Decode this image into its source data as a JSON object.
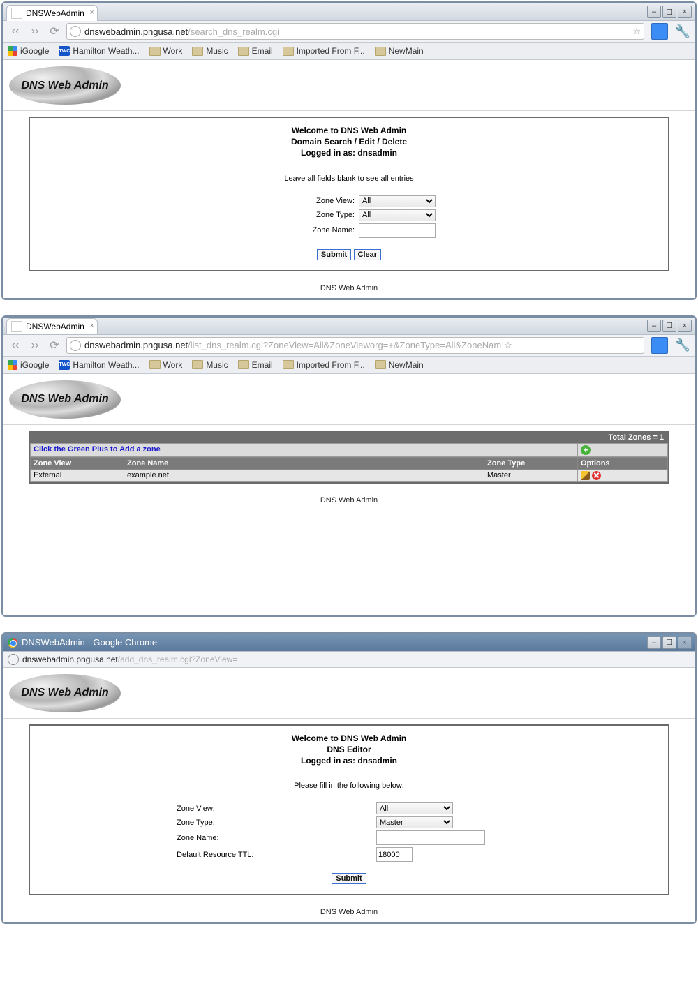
{
  "windows": [
    {
      "tab_title": "DNSWebAdmin",
      "url_host": "dnswebadmin.pngusa.net",
      "url_path": "/search_dns_realm.cgi"
    },
    {
      "tab_title": "DNSWebAdmin",
      "url_host": "dnswebadmin.pngusa.net",
      "url_path": "/list_dns_realm.cgi?ZoneView=All&ZoneVieworg=+&ZoneType=All&ZoneNam"
    },
    {
      "title": "DNSWebAdmin - Google Chrome",
      "url_host": "dnswebadmin.pngusa.net",
      "url_path": "/add_dns_realm.cgi?ZoneView="
    }
  ],
  "bookmarks": {
    "igoogle": "iGoogle",
    "hamilton": "Hamilton Weath...",
    "work": "Work",
    "music": "Music",
    "email": "Email",
    "imported": "Imported From F...",
    "newmain": "NewMain",
    "twc": "TWC"
  },
  "logo": "DNS Web Admin",
  "search_panel": {
    "h1": "Welcome to DNS Web Admin",
    "h2": "Domain Search / Edit / Delete",
    "h3": "Logged in as: dnsadmin",
    "hint": "Leave all fields blank to see all entries",
    "labels": {
      "view": "Zone View:",
      "type": "Zone Type:",
      "name": "Zone Name:"
    },
    "values": {
      "view": "All",
      "type": "All",
      "name": ""
    },
    "submit": "Submit",
    "clear": "Clear"
  },
  "list_panel": {
    "total": "Total Zones = 1",
    "add_hint": "Click the Green Plus to Add a zone",
    "cols": {
      "view": "Zone View",
      "name": "Zone Name",
      "type": "Zone Type",
      "opts": "Options"
    },
    "row": {
      "view": "External",
      "name": "example.net",
      "type": "Master"
    }
  },
  "editor_panel": {
    "h1": "Welcome to DNS Web Admin",
    "h2": "DNS Editor",
    "h3": "Logged in as: dnsadmin",
    "hint": "Please fill in the following below:",
    "labels": {
      "view": "Zone View:",
      "type": "Zone Type:",
      "name": "Zone Name:",
      "ttl": "Default Resource TTL:"
    },
    "values": {
      "view": "All",
      "type": "Master",
      "name": "",
      "ttl": "18000"
    },
    "submit": "Submit"
  },
  "footer": "DNS Web Admin"
}
